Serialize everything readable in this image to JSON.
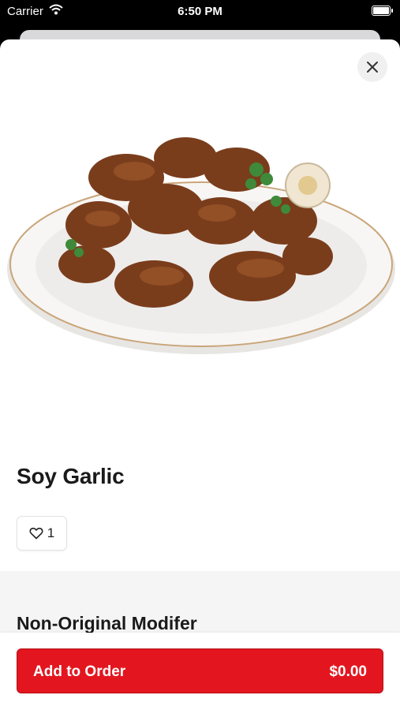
{
  "status_bar": {
    "carrier": "Carrier",
    "time": "6:50 PM"
  },
  "product": {
    "title": "Soy Garlic",
    "likes": "1"
  },
  "modifier": {
    "title": "Non-Original Modifer"
  },
  "order": {
    "add_label": "Add to Order",
    "price": "$0.00"
  },
  "icons": [
    "wifi-icon",
    "battery-icon",
    "close-icon",
    "heart-icon"
  ],
  "colors": {
    "accent": "#e3161f",
    "section_bg": "#f5f5f5"
  }
}
